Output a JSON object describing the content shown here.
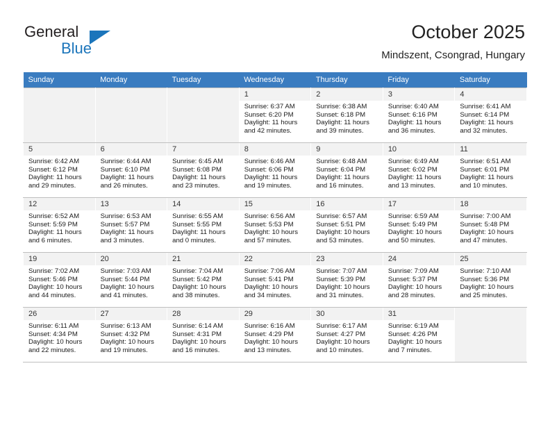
{
  "brand": {
    "word_one": "General",
    "word_two": "Blue",
    "logo_icon": "triangle-logo-icon",
    "accent_color": "#1b75bb"
  },
  "header": {
    "title": "October 2025",
    "subtitle": "Mindszent, Csongrad, Hungary"
  },
  "calendar": {
    "header_background": "#3a7cc0",
    "weekdays": [
      "Sunday",
      "Monday",
      "Tuesday",
      "Wednesday",
      "Thursday",
      "Friday",
      "Saturday"
    ],
    "weeks": [
      [
        {
          "empty": true
        },
        {
          "empty": true
        },
        {
          "empty": true
        },
        {
          "day": "1",
          "sunrise": "Sunrise: 6:37 AM",
          "sunset": "Sunset: 6:20 PM",
          "daylight": "Daylight: 11 hours and 42 minutes."
        },
        {
          "day": "2",
          "sunrise": "Sunrise: 6:38 AM",
          "sunset": "Sunset: 6:18 PM",
          "daylight": "Daylight: 11 hours and 39 minutes."
        },
        {
          "day": "3",
          "sunrise": "Sunrise: 6:40 AM",
          "sunset": "Sunset: 6:16 PM",
          "daylight": "Daylight: 11 hours and 36 minutes."
        },
        {
          "day": "4",
          "sunrise": "Sunrise: 6:41 AM",
          "sunset": "Sunset: 6:14 PM",
          "daylight": "Daylight: 11 hours and 32 minutes."
        }
      ],
      [
        {
          "day": "5",
          "sunrise": "Sunrise: 6:42 AM",
          "sunset": "Sunset: 6:12 PM",
          "daylight": "Daylight: 11 hours and 29 minutes."
        },
        {
          "day": "6",
          "sunrise": "Sunrise: 6:44 AM",
          "sunset": "Sunset: 6:10 PM",
          "daylight": "Daylight: 11 hours and 26 minutes."
        },
        {
          "day": "7",
          "sunrise": "Sunrise: 6:45 AM",
          "sunset": "Sunset: 6:08 PM",
          "daylight": "Daylight: 11 hours and 23 minutes."
        },
        {
          "day": "8",
          "sunrise": "Sunrise: 6:46 AM",
          "sunset": "Sunset: 6:06 PM",
          "daylight": "Daylight: 11 hours and 19 minutes."
        },
        {
          "day": "9",
          "sunrise": "Sunrise: 6:48 AM",
          "sunset": "Sunset: 6:04 PM",
          "daylight": "Daylight: 11 hours and 16 minutes."
        },
        {
          "day": "10",
          "sunrise": "Sunrise: 6:49 AM",
          "sunset": "Sunset: 6:02 PM",
          "daylight": "Daylight: 11 hours and 13 minutes."
        },
        {
          "day": "11",
          "sunrise": "Sunrise: 6:51 AM",
          "sunset": "Sunset: 6:01 PM",
          "daylight": "Daylight: 11 hours and 10 minutes."
        }
      ],
      [
        {
          "day": "12",
          "sunrise": "Sunrise: 6:52 AM",
          "sunset": "Sunset: 5:59 PM",
          "daylight": "Daylight: 11 hours and 6 minutes."
        },
        {
          "day": "13",
          "sunrise": "Sunrise: 6:53 AM",
          "sunset": "Sunset: 5:57 PM",
          "daylight": "Daylight: 11 hours and 3 minutes."
        },
        {
          "day": "14",
          "sunrise": "Sunrise: 6:55 AM",
          "sunset": "Sunset: 5:55 PM",
          "daylight": "Daylight: 11 hours and 0 minutes."
        },
        {
          "day": "15",
          "sunrise": "Sunrise: 6:56 AM",
          "sunset": "Sunset: 5:53 PM",
          "daylight": "Daylight: 10 hours and 57 minutes."
        },
        {
          "day": "16",
          "sunrise": "Sunrise: 6:57 AM",
          "sunset": "Sunset: 5:51 PM",
          "daylight": "Daylight: 10 hours and 53 minutes."
        },
        {
          "day": "17",
          "sunrise": "Sunrise: 6:59 AM",
          "sunset": "Sunset: 5:49 PM",
          "daylight": "Daylight: 10 hours and 50 minutes."
        },
        {
          "day": "18",
          "sunrise": "Sunrise: 7:00 AM",
          "sunset": "Sunset: 5:48 PM",
          "daylight": "Daylight: 10 hours and 47 minutes."
        }
      ],
      [
        {
          "day": "19",
          "sunrise": "Sunrise: 7:02 AM",
          "sunset": "Sunset: 5:46 PM",
          "daylight": "Daylight: 10 hours and 44 minutes."
        },
        {
          "day": "20",
          "sunrise": "Sunrise: 7:03 AM",
          "sunset": "Sunset: 5:44 PM",
          "daylight": "Daylight: 10 hours and 41 minutes."
        },
        {
          "day": "21",
          "sunrise": "Sunrise: 7:04 AM",
          "sunset": "Sunset: 5:42 PM",
          "daylight": "Daylight: 10 hours and 38 minutes."
        },
        {
          "day": "22",
          "sunrise": "Sunrise: 7:06 AM",
          "sunset": "Sunset: 5:41 PM",
          "daylight": "Daylight: 10 hours and 34 minutes."
        },
        {
          "day": "23",
          "sunrise": "Sunrise: 7:07 AM",
          "sunset": "Sunset: 5:39 PM",
          "daylight": "Daylight: 10 hours and 31 minutes."
        },
        {
          "day": "24",
          "sunrise": "Sunrise: 7:09 AM",
          "sunset": "Sunset: 5:37 PM",
          "daylight": "Daylight: 10 hours and 28 minutes."
        },
        {
          "day": "25",
          "sunrise": "Sunrise: 7:10 AM",
          "sunset": "Sunset: 5:36 PM",
          "daylight": "Daylight: 10 hours and 25 minutes."
        }
      ],
      [
        {
          "day": "26",
          "sunrise": "Sunrise: 6:11 AM",
          "sunset": "Sunset: 4:34 PM",
          "daylight": "Daylight: 10 hours and 22 minutes."
        },
        {
          "day": "27",
          "sunrise": "Sunrise: 6:13 AM",
          "sunset": "Sunset: 4:32 PM",
          "daylight": "Daylight: 10 hours and 19 minutes."
        },
        {
          "day": "28",
          "sunrise": "Sunrise: 6:14 AM",
          "sunset": "Sunset: 4:31 PM",
          "daylight": "Daylight: 10 hours and 16 minutes."
        },
        {
          "day": "29",
          "sunrise": "Sunrise: 6:16 AM",
          "sunset": "Sunset: 4:29 PM",
          "daylight": "Daylight: 10 hours and 13 minutes."
        },
        {
          "day": "30",
          "sunrise": "Sunrise: 6:17 AM",
          "sunset": "Sunset: 4:27 PM",
          "daylight": "Daylight: 10 hours and 10 minutes."
        },
        {
          "day": "31",
          "sunrise": "Sunrise: 6:19 AM",
          "sunset": "Sunset: 4:26 PM",
          "daylight": "Daylight: 10 hours and 7 minutes."
        },
        {
          "empty": true
        }
      ]
    ]
  }
}
